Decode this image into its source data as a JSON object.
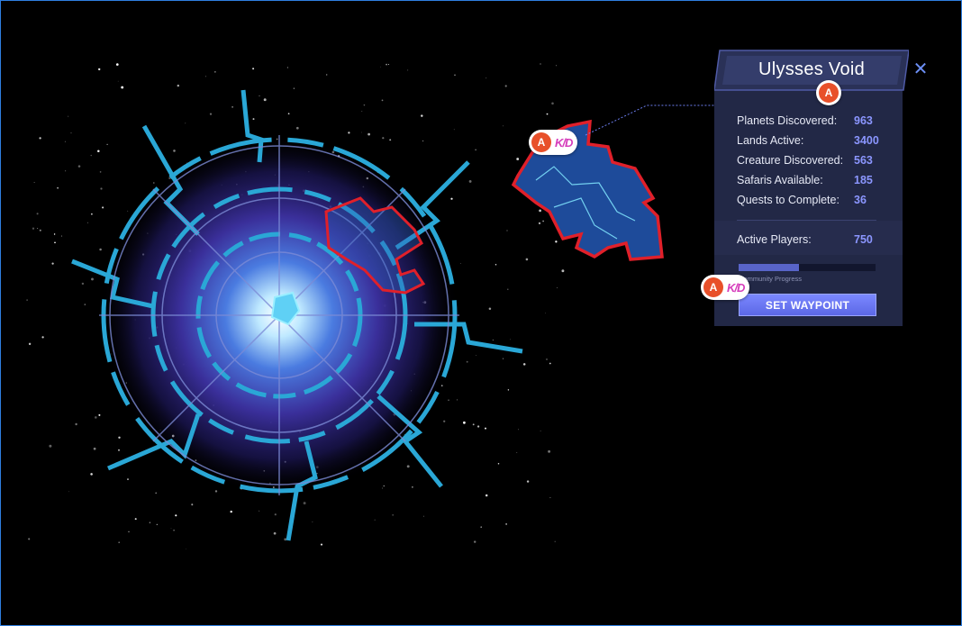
{
  "panel": {
    "title": "Ulysses Void",
    "close_label": "✕",
    "stats": [
      {
        "label": "Planets Discovered:",
        "value": "963"
      },
      {
        "label": "Lands Active:",
        "value": "3400"
      },
      {
        "label": "Creature Discovered:",
        "value": "563"
      },
      {
        "label": "Safaris Available:",
        "value": "185"
      },
      {
        "label": "Quests to Complete:",
        "value": "36"
      }
    ],
    "active_players": {
      "label": "Active Players:",
      "value": "750"
    },
    "progress": {
      "label": "Community Progress",
      "fraction": 0.44
    },
    "waypoint_button": "SET WAYPOINT"
  },
  "badges": {
    "letter": "A",
    "logo_text": "K/D"
  },
  "colors": {
    "accent": "#8b96ff",
    "badge_orange": "#e8502a",
    "selection_red": "#e0202a",
    "sector_blue": "#2aa7d6"
  }
}
